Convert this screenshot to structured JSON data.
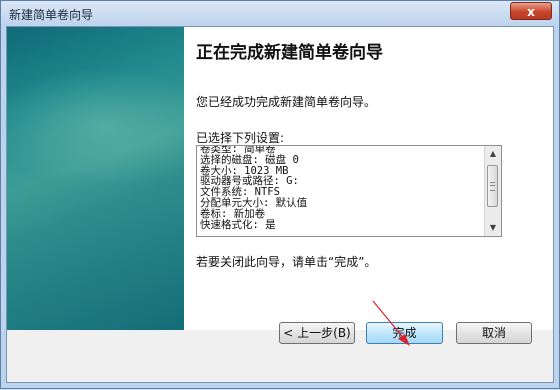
{
  "window": {
    "title": "新建简单卷向导",
    "close_label": "x"
  },
  "content": {
    "heading": "正在完成新建简单卷向导",
    "success_text": "您已经成功完成新建简单卷向导。",
    "settings_label": "已选择下列设置:",
    "settings_lines": [
      "卷类型: 简单卷",
      "选择的磁盘: 磁盘 0",
      "卷大小: 1023 MB",
      "驱动器号或路径: G:",
      "文件系统: NTFS",
      "分配单元大小: 默认值",
      "卷标: 新加卷",
      "快速格式化: 是"
    ],
    "close_hint": "若要关闭此向导，请单击“完成”。"
  },
  "scrollbar": {
    "up_icon": "scroll-up-arrow",
    "down_icon": "scroll-down-arrow"
  },
  "buttons": {
    "back": "< 上一步(B)",
    "finish": "完成",
    "cancel": "取消"
  },
  "colors": {
    "accent_arrow": "#e0202a",
    "side_panel": "#1f7f86"
  }
}
